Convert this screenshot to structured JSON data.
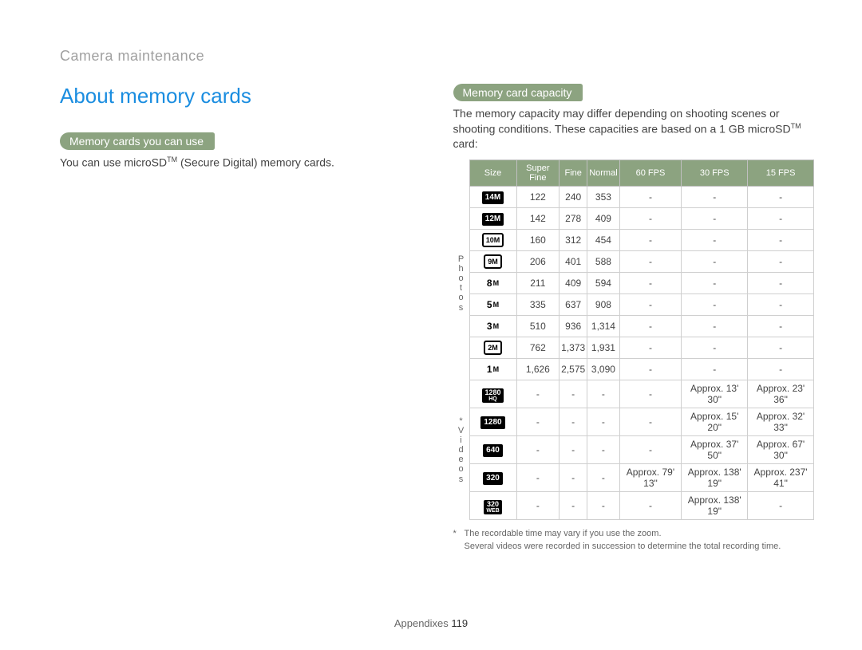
{
  "breadcrumb": "Camera maintenance",
  "section_title": "About memory cards",
  "left": {
    "pill": "Memory cards you can use",
    "body_before_tm": "You can use microSD",
    "tm": "TM",
    "body_after_tm": " (Secure Digital) memory cards."
  },
  "right": {
    "pill": "Memory card capacity",
    "body_before_tm": "The memory capacity may differ depending on shooting scenes or shooting conditions. These capacities are based on a 1 GB microSD",
    "tm": "TM",
    "body_after_tm": " card:"
  },
  "table": {
    "headers": [
      "Size",
      "Super Fine",
      "Fine",
      "Normal",
      "60 FPS",
      "30 FPS",
      "15 FPS"
    ],
    "group_photos": "Photos",
    "group_videos": "Videos",
    "videos_star": "*",
    "photo_rows": [
      {
        "size": "14M",
        "icon": "solid",
        "sf": "122",
        "f": "240",
        "n": "353",
        "f60": "-",
        "f30": "-",
        "f15": "-"
      },
      {
        "size": "12M",
        "icon": "solid",
        "sf": "142",
        "f": "278",
        "n": "409",
        "f60": "-",
        "f30": "-",
        "f15": "-"
      },
      {
        "size": "10M",
        "icon": "box",
        "sf": "160",
        "f": "312",
        "n": "454",
        "f60": "-",
        "f30": "-",
        "f15": "-"
      },
      {
        "size": "9M",
        "icon": "box",
        "sf": "206",
        "f": "401",
        "n": "588",
        "f60": "-",
        "f30": "-",
        "f15": "-"
      },
      {
        "size": "8M",
        "icon": "txt",
        "sf": "211",
        "f": "409",
        "n": "594",
        "f60": "-",
        "f30": "-",
        "f15": "-"
      },
      {
        "size": "5M",
        "icon": "txt",
        "sf": "335",
        "f": "637",
        "n": "908",
        "f60": "-",
        "f30": "-",
        "f15": "-"
      },
      {
        "size": "3M",
        "icon": "txt",
        "sf": "510",
        "f": "936",
        "n": "1,314",
        "f60": "-",
        "f30": "-",
        "f15": "-"
      },
      {
        "size": "2M",
        "icon": "box",
        "sf": "762",
        "f": "1,373",
        "n": "1,931",
        "f60": "-",
        "f30": "-",
        "f15": "-"
      },
      {
        "size": "1M",
        "icon": "txt",
        "sf": "1,626",
        "f": "2,575",
        "n": "3,090",
        "f60": "-",
        "f30": "-",
        "f15": "-"
      }
    ],
    "video_rows": [
      {
        "size": "1280 HQ",
        "icon": "solid2",
        "sf": "-",
        "f": "-",
        "n": "-",
        "f60": "-",
        "f30": "Approx. 13' 30\"",
        "f15": "Approx. 23' 36\""
      },
      {
        "size": "1280",
        "icon": "solid",
        "sf": "-",
        "f": "-",
        "n": "-",
        "f60": "-",
        "f30": "Approx. 15' 20\"",
        "f15": "Approx. 32' 33\""
      },
      {
        "size": "640",
        "icon": "solid",
        "sf": "-",
        "f": "-",
        "n": "-",
        "f60": "-",
        "f30": "Approx. 37' 50\"",
        "f15": "Approx. 67' 30\""
      },
      {
        "size": "320",
        "icon": "solid",
        "sf": "-",
        "f": "-",
        "n": "-",
        "f60": "Approx. 79' 13\"",
        "f30": "Approx. 138' 19\"",
        "f15": "Approx. 237' 41\""
      },
      {
        "size": "320 WEB",
        "icon": "solid2",
        "sf": "-",
        "f": "-",
        "n": "-",
        "f60": "-",
        "f30": "Approx. 138' 19\"",
        "f15": "-"
      }
    ]
  },
  "notes": {
    "n1_bullet": "*",
    "n1": "The recordable time may vary if you use the zoom.",
    "n2": "Several videos were recorded in succession to determine the total recording time."
  },
  "footer": {
    "label": "Appendixes",
    "page": "119"
  }
}
